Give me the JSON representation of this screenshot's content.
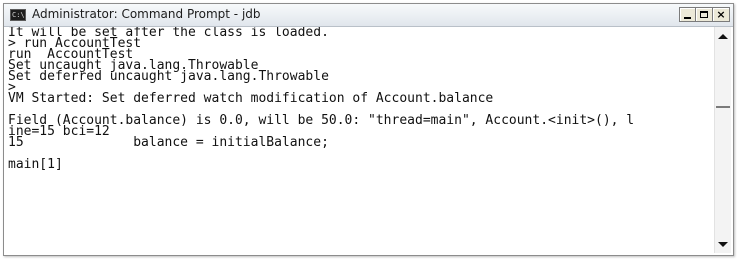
{
  "window": {
    "title": "Administrator: Command Prompt - jdb",
    "icon_text": "C:\\"
  },
  "console": {
    "lines": [
      "It will be set after the class is loaded.",
      "> run AccountTest",
      "run  AccountTest",
      "Set uncaught java.lang.Throwable",
      "Set deferred uncaught java.lang.Throwable",
      ">",
      "VM Started: Set deferred watch modification of Account.balance",
      "",
      "Field (Account.balance) is 0.0, will be 50.0: \"thread=main\", Account.<init>(), l",
      "ine=15 bci=12",
      "15              balance = initialBalance;",
      "",
      "main[1]"
    ]
  },
  "icons": {
    "app": "console-window-icon",
    "minimize": "minimize-icon",
    "maximize": "maximize-icon",
    "close": "close-icon",
    "scroll_up": "scroll-up-arrow-icon",
    "scroll_down": "scroll-down-arrow-icon"
  }
}
